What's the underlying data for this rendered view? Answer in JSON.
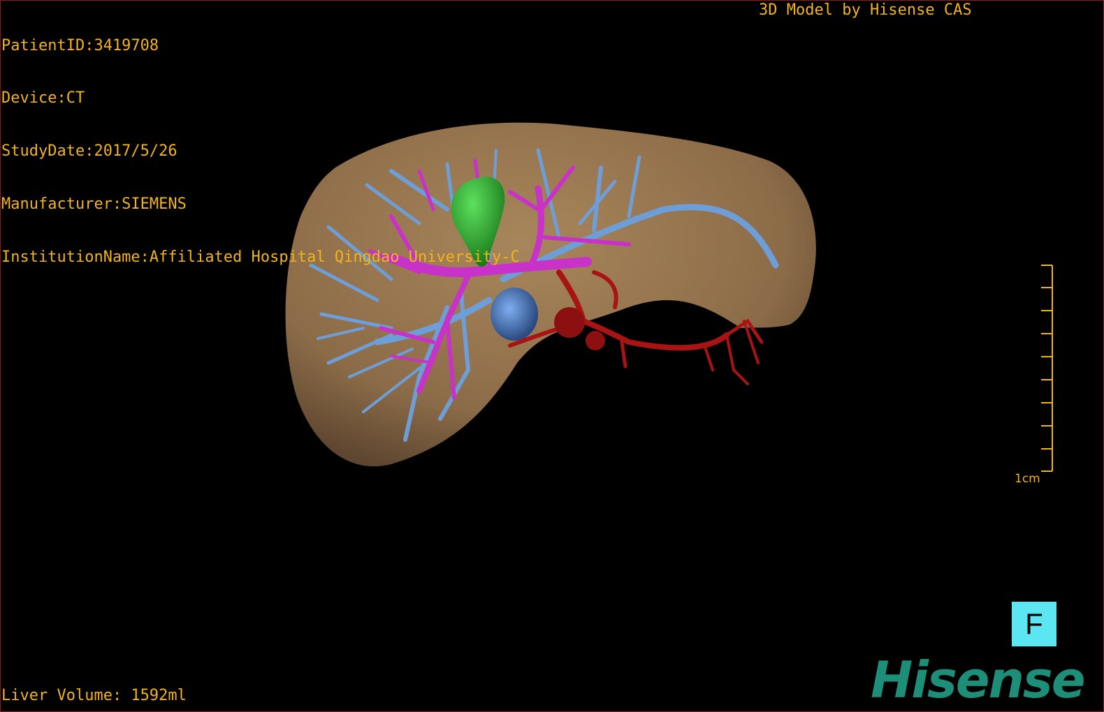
{
  "header": {
    "patient_id": "PatientID:3419708",
    "device": "Device:CT",
    "study_date": "StudyDate:2017/5/26",
    "manufacturer": "Manufacturer:SIEMENS",
    "institution": "InstitutionName:Affiliated Hospital Qingdao University-C",
    "model_by": "3D Model by Hisense CAS"
  },
  "footer": {
    "liver_volume": "Liver Volume: 1592ml"
  },
  "scale_bar": {
    "label": "1cm"
  },
  "orientation_marker": {
    "label": "F"
  },
  "logo": {
    "text": "Hisense"
  },
  "colors": {
    "text": "#f2b418",
    "liver": "#9c7a52",
    "hepatic_vein": "#6e9ed8",
    "portal_vein": "#c832c8",
    "artery": "#a81414",
    "gallbladder": "#2aa82a",
    "orientation_bg": "#5ce6f2",
    "logo": "#1d8f78"
  }
}
